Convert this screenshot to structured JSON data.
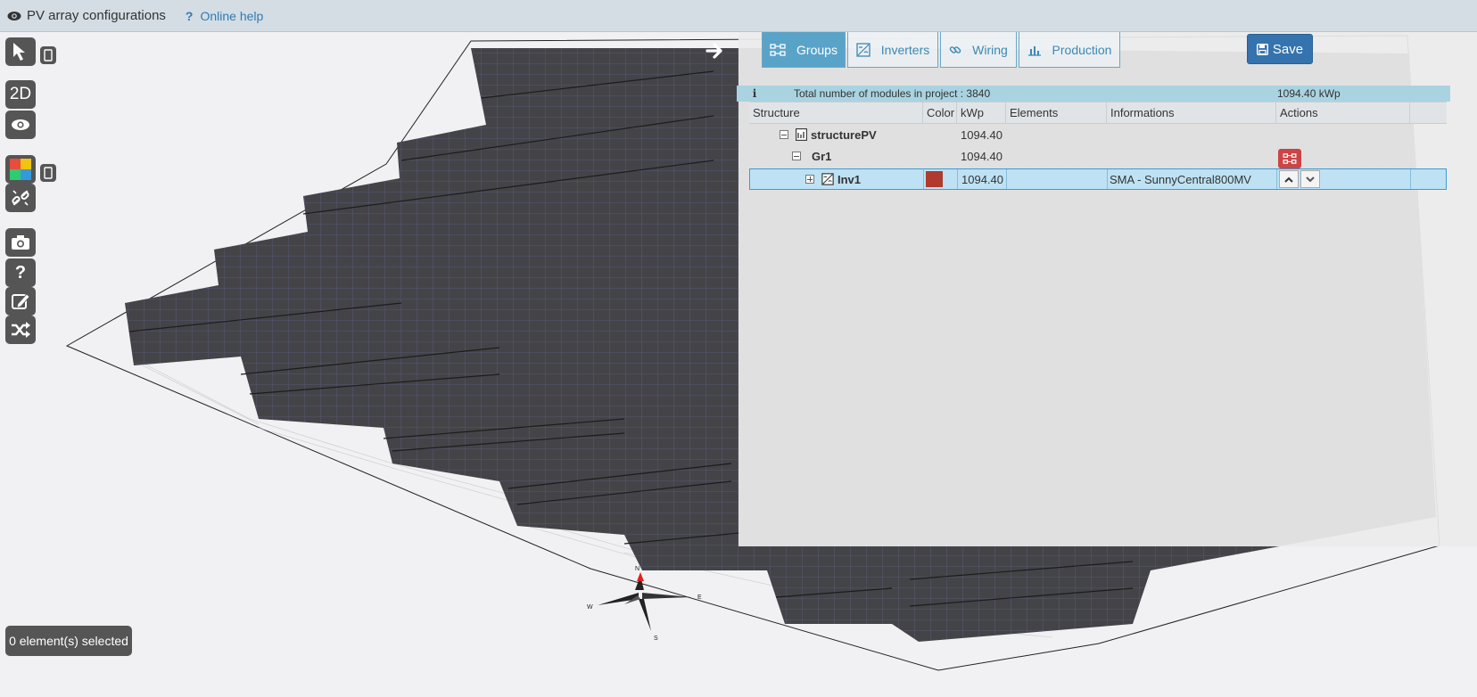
{
  "header": {
    "title": "PV array configurations",
    "help_label": "Online help"
  },
  "toolbar": {
    "view_2d_label": "2D"
  },
  "compass": {
    "n": "N",
    "e": "E",
    "s": "S",
    "w": "W"
  },
  "panel": {
    "tabs": [
      {
        "label": "Groups",
        "icon": "groups-icon",
        "active": true
      },
      {
        "label": "Inverters",
        "icon": "inverter-icon",
        "active": false
      },
      {
        "label": "Wiring",
        "icon": "link-icon",
        "active": false
      },
      {
        "label": "Production",
        "icon": "bar-chart-icon",
        "active": false
      }
    ],
    "save_label": "Save",
    "info": {
      "icon": "info-icon",
      "total_text": "Total number of modules in project : 3840",
      "total_kwp": "1094.40 kWp"
    },
    "columns": [
      "Structure",
      "Color",
      "kWp",
      "Elements",
      "Informations",
      "Actions"
    ],
    "rows": [
      {
        "name": "structurePV",
        "kwp": "1094.40",
        "elements": "",
        "info": ""
      },
      {
        "name": "Gr1",
        "kwp": "1094.40",
        "elements": "",
        "info": ""
      },
      {
        "name": "Inv1",
        "kwp": "1094.40",
        "elements": "",
        "info": "SMA - SunnyCentral800MV",
        "color": "#b03a2e"
      }
    ]
  },
  "status": {
    "selected_text": "0 element(s) selected"
  },
  "colors": {
    "accent": "#5aa3c8",
    "save": "#3473ad",
    "panel_module": "#444448",
    "inverter_color": "#b03a2e",
    "danger": "#cc4444"
  }
}
